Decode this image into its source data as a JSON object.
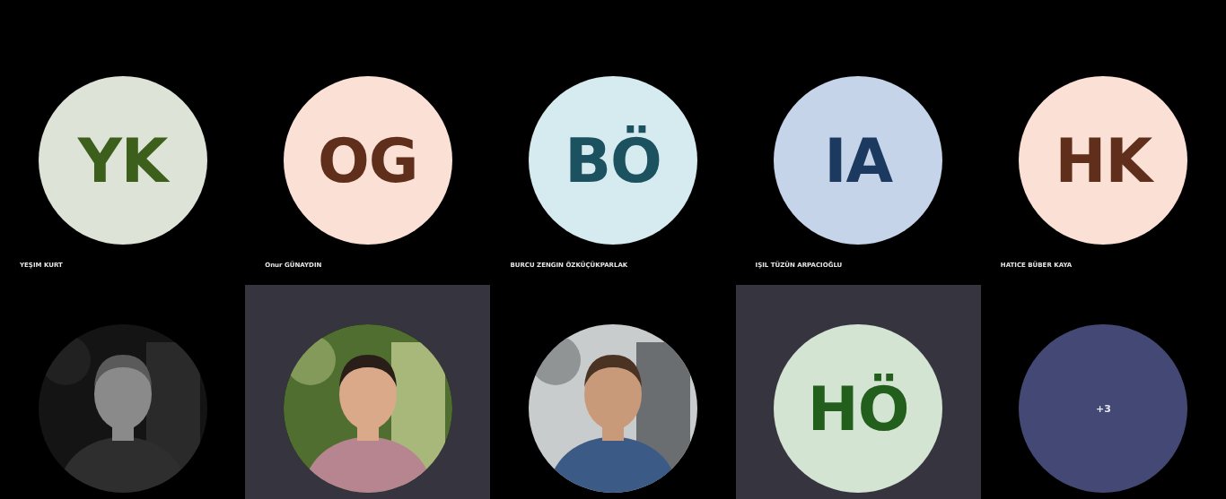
{
  "tiles": [
    {
      "kind": "initials",
      "initials": "YK",
      "color": "#dde3d7",
      "name": "YEŞIM KURT",
      "highlighted": false
    },
    {
      "kind": "initials",
      "initials": "OG",
      "color": "#fbe0d5",
      "name": "Onur GÜNAYDIN",
      "highlighted": false
    },
    {
      "kind": "initials",
      "initials": "BÖ",
      "color": "#d6ebf0",
      "name": "BURCU ZENGIN ÖZKÜÇÜKPARLAK",
      "highlighted": false
    },
    {
      "kind": "initials",
      "initials": "IA",
      "color": "#c5d4e8",
      "name": "IŞIL TÜZÜN ARPACIOĞLU",
      "highlighted": false
    },
    {
      "kind": "initials",
      "initials": "HK",
      "color": "#fbe0d5",
      "name": "HATICE BÜBER KAYA",
      "highlighted": false
    },
    {
      "kind": "picture",
      "highlighted": false
    },
    {
      "kind": "picture",
      "highlighted": true
    },
    {
      "kind": "picture",
      "highlighted": false
    },
    {
      "kind": "initials",
      "initials": "HÖ",
      "color": "#d4e4d2",
      "highlighted": true
    },
    {
      "kind": "overflow",
      "count": "+3",
      "color": "#444875",
      "highlighted": false
    }
  ]
}
